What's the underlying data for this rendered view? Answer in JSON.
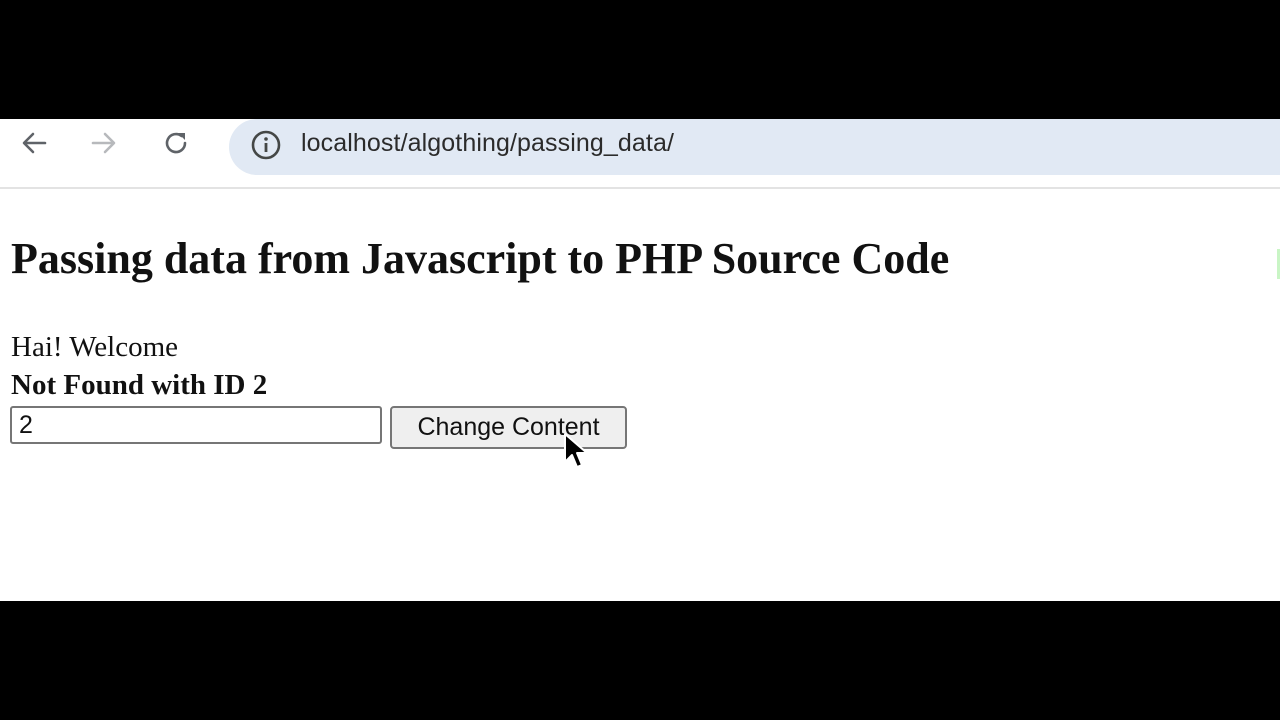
{
  "browser": {
    "url": "localhost/algothing/passing_data/",
    "icons": {
      "back": "arrow-left-icon",
      "forward": "arrow-right-icon",
      "reload": "reload-icon",
      "site_info": "info-icon",
      "cursor": "mouse-pointer-icon"
    }
  },
  "page": {
    "heading": "Passing data from Javascript to PHP Source Code",
    "welcome_text": "Hai! Welcome",
    "result_text": "Not Found with ID 2",
    "id_input_value": "2",
    "button_label": "Change Content"
  },
  "colors": {
    "omnibox_background": "#e1e9f4",
    "page_background": "#ffffff",
    "letterbox": "#000000",
    "button_background": "#efefef"
  }
}
